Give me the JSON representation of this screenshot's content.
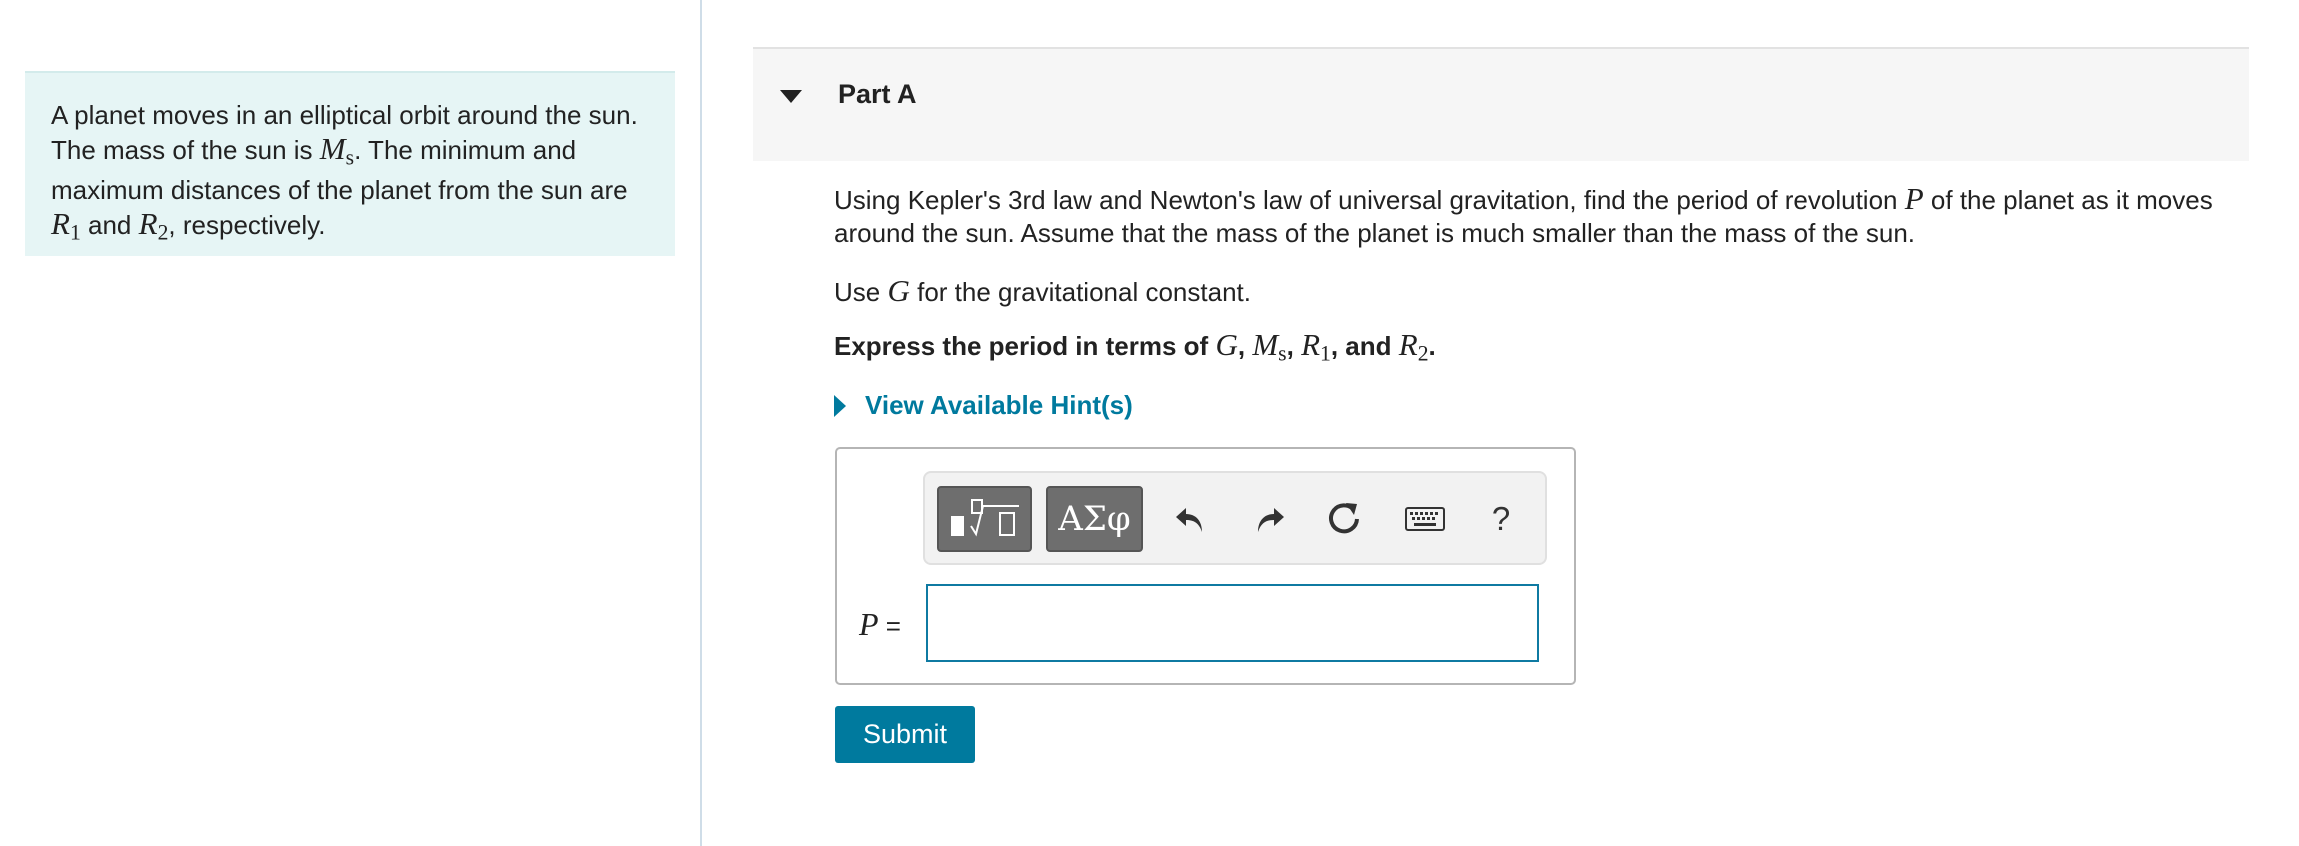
{
  "intro": {
    "s1": "A planet moves in an elliptical orbit around the sun.",
    "s2a": "The mass of the sun is",
    "ms_var": "M",
    "ms_sub": "s",
    "s2b": ". The minimum and",
    "s3": "maximum distances of the planet from the sun are",
    "r_var": "R",
    "r1_sub": "1",
    "and": "and",
    "r2_sub": "2",
    "s4": ", respectively."
  },
  "part": {
    "title": "Part A"
  },
  "question": {
    "q1a": "Using Kepler's 3rd law and Newton's law of universal gravitation, find the period of revolution",
    "p_var": "P",
    "q1b": "of the planet as it moves around the sun. Assume that the mass of the planet is much smaller than the mass of the sun.",
    "q2a": "Use",
    "g_var": "G",
    "q2b": "for the gravitational constant.",
    "q3a": "Express the period in terms of",
    "q3_comma": ",",
    "q3_and": ", and",
    "q3_end": "."
  },
  "hint": {
    "label": "View Available Hint(s)"
  },
  "toolbar": {
    "symbols_label": "ΑΣφ",
    "help_label": "?"
  },
  "answer": {
    "variable": "P",
    "equals": "=",
    "value": ""
  },
  "submit": {
    "label": "Submit"
  },
  "colors": {
    "accent": "#007a9e",
    "intro_bg": "#e6f5f5",
    "header_bg": "#f6f6f6"
  }
}
